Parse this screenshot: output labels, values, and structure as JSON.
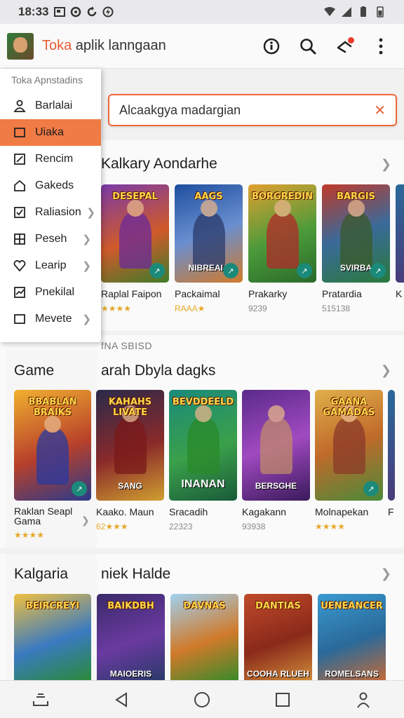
{
  "status": {
    "time": "18:33"
  },
  "appbar": {
    "title_accent": "Toka",
    "title_rest": " aplik lanngaan"
  },
  "search": {
    "value": "Alcaakgya madargian"
  },
  "drawer": {
    "header": "Toka Apnstadins",
    "items": [
      {
        "label": "Barlalai",
        "icon": "person-icon",
        "chevron": false,
        "active": false
      },
      {
        "label": "Uiaka",
        "icon": "square-icon",
        "chevron": false,
        "active": true
      },
      {
        "label": "Rencim",
        "icon": "edit-icon",
        "chevron": false,
        "active": false
      },
      {
        "label": "Gakeds",
        "icon": "home-icon",
        "chevron": false,
        "active": false
      },
      {
        "label": "Raliasion",
        "icon": "checkbox-icon",
        "chevron": true,
        "active": false
      },
      {
        "label": "Peseh",
        "icon": "grid-icon",
        "chevron": true,
        "active": false
      },
      {
        "label": "Learip",
        "icon": "heart-icon",
        "chevron": true,
        "active": false
      },
      {
        "label": "Pnekilal",
        "icon": "chart-icon",
        "chevron": false,
        "active": false
      },
      {
        "label": "Mevete",
        "icon": "square-icon",
        "chevron": true,
        "active": false
      }
    ]
  },
  "sections": [
    {
      "title": "Kalkary Aondarhe",
      "cards": [
        {
          "name": "Raplal Faipon",
          "rating": "★★★★",
          "logo": "DESEPAL",
          "bottom": ""
        },
        {
          "name": "Packaimal",
          "rating": "RAAA★",
          "logo": "AAGS",
          "bottom": "NIBREAIA"
        },
        {
          "name": "Prakarky",
          "rating": "9239",
          "logo": "BORGREDIN",
          "bottom": ""
        },
        {
          "name": "Pratardia",
          "rating": "515138",
          "logo": "BARGIS",
          "bottom": "SVIRBA"
        },
        {
          "name": "K",
          "rating": "",
          "logo": "",
          "bottom": ""
        }
      ]
    },
    {
      "label": "fNA SBISD",
      "left_title": "Game",
      "title": "arah Dbyla dagks",
      "cards": [
        {
          "name": "Raklan Seapl Gama",
          "rating": "★★★★",
          "logo": "BBABLAN BRAIKS",
          "bottom": ""
        },
        {
          "name": "Kaako. Maun",
          "rating": "62★★★",
          "logo": "KAHAHS LIVATE",
          "bottom": "SANG"
        },
        {
          "name": "Sracadih",
          "rating": "22323",
          "logo": "BEVDDEELD",
          "bottom": "INANAN"
        },
        {
          "name": "Kagakann",
          "rating": "93938",
          "logo": "",
          "bottom": "BERSGHE"
        },
        {
          "name": "Molnapekan",
          "rating": "★★★★",
          "logo": "GAANA GAMADAS",
          "bottom": ""
        },
        {
          "name": "F S",
          "rating": "",
          "logo": "",
          "bottom": ""
        }
      ]
    },
    {
      "left_title": "Kalgaria",
      "title": "niek Halde",
      "cards": [
        {
          "name": "",
          "rating": "",
          "logo": "BEIRCREYI",
          "bottom": ""
        },
        {
          "name": "",
          "rating": "",
          "logo": "BAIKDBH",
          "bottom": "MAIOERIS"
        },
        {
          "name": "",
          "rating": "",
          "logo": "DAVNAS",
          "bottom": ""
        },
        {
          "name": "",
          "rating": "",
          "logo": "DANTIAS",
          "bottom": "COOHA RLUEH"
        },
        {
          "name": "",
          "rating": "",
          "logo": "UENEANCER",
          "bottom": "ROMELSANS"
        }
      ]
    }
  ],
  "colors": {
    "accent": "#f17b45",
    "search_border": "#ef6a3a",
    "badge": "#e83b2a"
  }
}
